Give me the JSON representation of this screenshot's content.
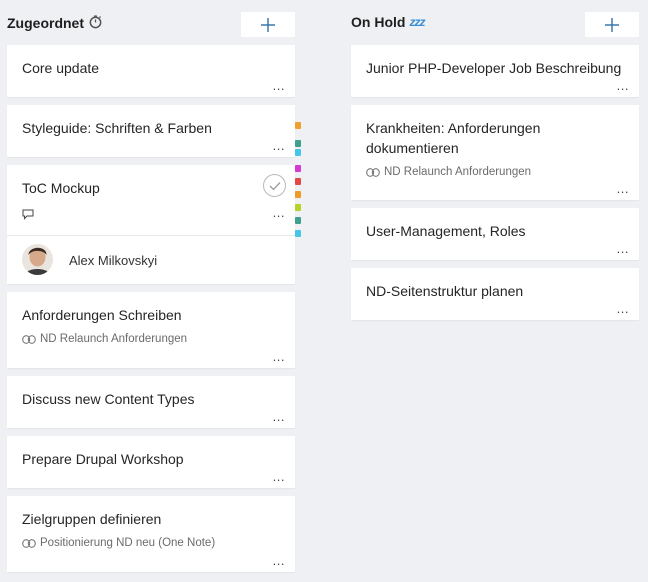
{
  "columns": {
    "left": {
      "title": "Zugeordnet",
      "title_icon": "stopwatch-icon",
      "add_label": "+",
      "cards": [
        {
          "title": "Core update",
          "more": "..."
        },
        {
          "title": "Styleguide: Schriften & Farben",
          "more": "..."
        },
        {
          "title": "ToC Mockup",
          "more": "...",
          "assignee": "Alex Milkovskyi"
        },
        {
          "title": "Anforderungen Schreiben",
          "link": "ND Relaunch Anforderungen",
          "more": "..."
        },
        {
          "title": "Discuss new Content Types",
          "more": "..."
        },
        {
          "title": "Prepare Drupal Workshop",
          "more": "..."
        },
        {
          "title": "Zielgruppen definieren",
          "link": "Positionierung ND neu (One Note)",
          "more": "..."
        }
      ]
    },
    "right": {
      "title": "On Hold",
      "title_icon": "zzz-icon",
      "title_emoji": "zzz",
      "add_label": "+",
      "cards": [
        {
          "title": "Junior PHP-Developer Job Beschreibung",
          "more": "..."
        },
        {
          "title": "Krankheiten: Anforderungen dokumentieren",
          "link": "ND Relaunch Anforderungen",
          "more": "..."
        },
        {
          "title": "User-Management, Roles",
          "more": "..."
        },
        {
          "title": "ND-Seitenstruktur planen",
          "more": "..."
        }
      ]
    }
  },
  "label_colors": [
    "#f0a030",
    "#3fa08f",
    "#45c6e6",
    "#d63ad6",
    "#e24848",
    "#f09a28",
    "#b4d228",
    "#3fa08f",
    "#45c6e6"
  ],
  "accent": "#2f6fa7"
}
